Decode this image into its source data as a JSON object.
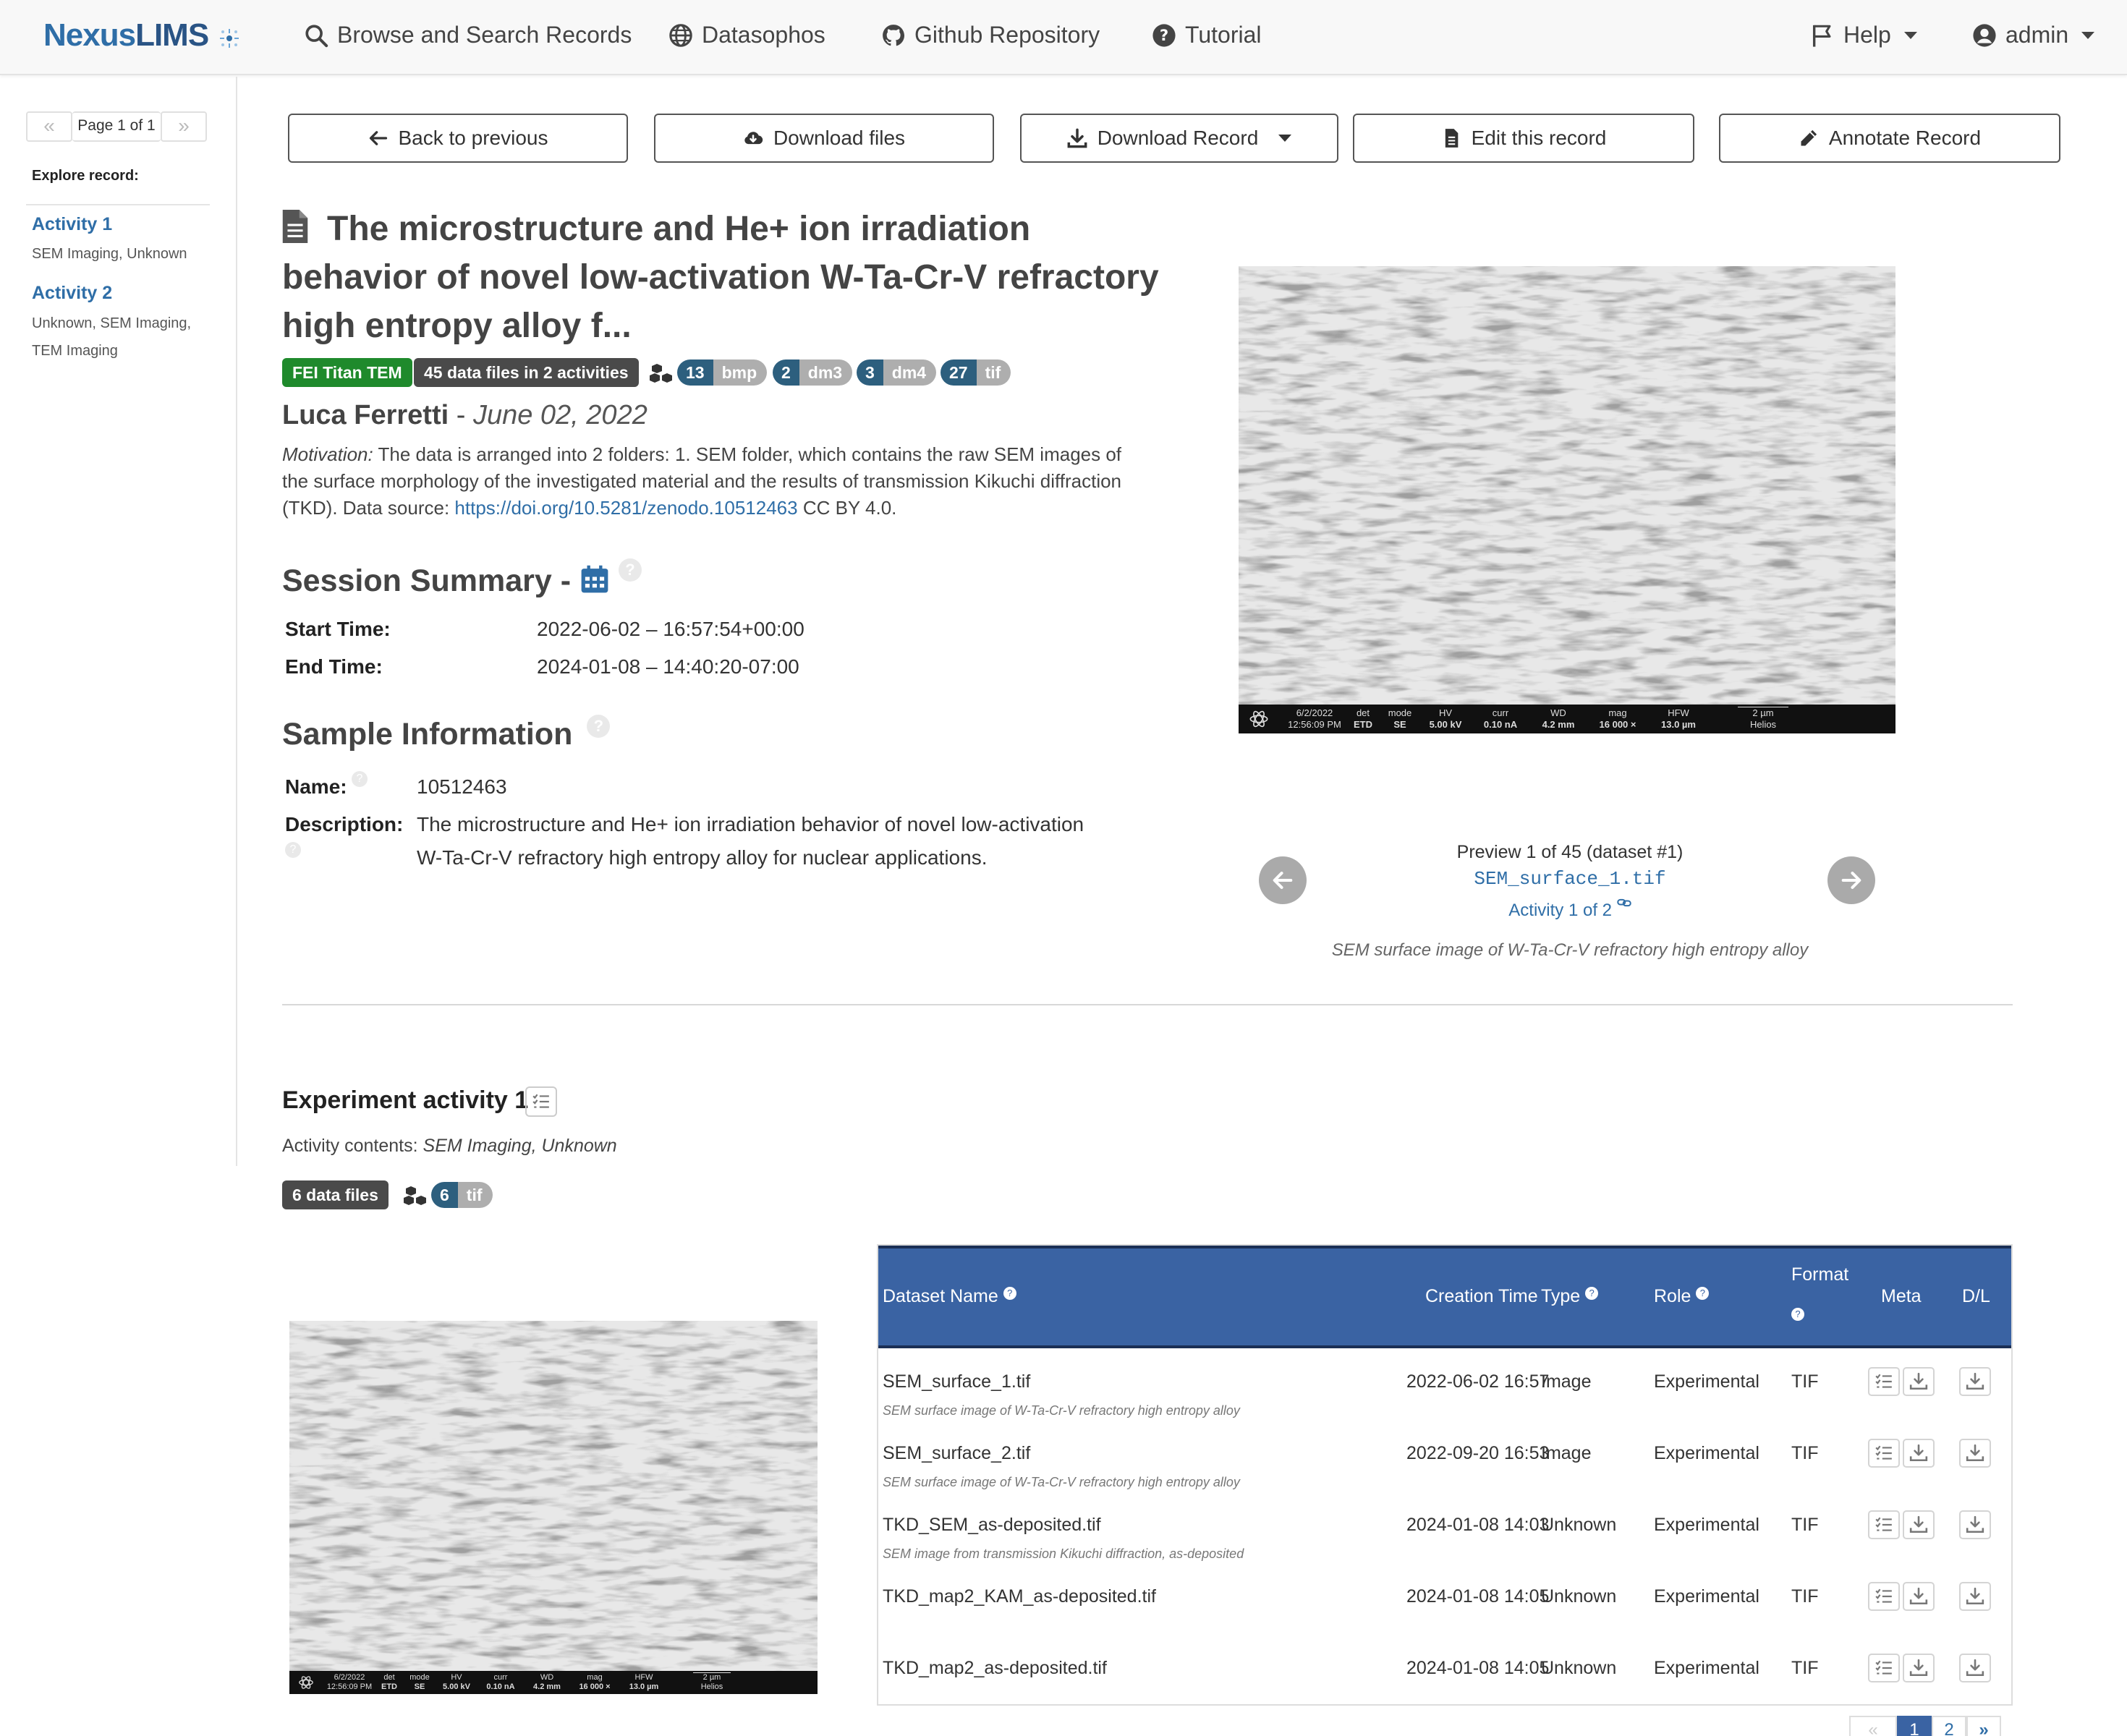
{
  "navbar": {
    "brand_nexus": "Nexus",
    "brand_lims": "LIMS",
    "items": [
      {
        "label": "Browse and Search Records",
        "icon": "search-icon"
      },
      {
        "label": "Datasophos",
        "icon": "globe-icon"
      },
      {
        "label": "Github Repository",
        "icon": "github-icon"
      },
      {
        "label": "Tutorial",
        "icon": "question-circle-icon"
      }
    ],
    "help": "Help",
    "user": "admin"
  },
  "sidebar": {
    "page_label": "Page 1 of 1",
    "explore_label": "Explore record:",
    "activities": [
      {
        "label": "Activity 1",
        "sub": "SEM Imaging, Unknown"
      },
      {
        "label": "Activity 2",
        "sub_line1": "Unknown, SEM Imaging,",
        "sub_line2": "TEM Imaging"
      }
    ]
  },
  "toolbar": {
    "back": "Back to previous",
    "download_files": "Download files",
    "download_record": "Download Record",
    "edit": "Edit this record",
    "annotate": "Annotate Record"
  },
  "record": {
    "title_line1": "The microstructure and He+ ion irradiation",
    "title_line2": "behavior of novel low-activation W-Ta-Cr-V refractory",
    "title_line3": "high entropy alloy f...",
    "instrument_badge": "FEI Titan TEM",
    "files_badge": "45 data files in 2 activities",
    "filetypes": [
      {
        "count": "13",
        "ext": "bmp"
      },
      {
        "count": "2",
        "ext": "dm3"
      },
      {
        "count": "3",
        "ext": "dm4"
      },
      {
        "count": "27",
        "ext": "tif"
      }
    ],
    "author": "Luca Ferretti",
    "date": "June 02, 2022",
    "motivation_label": "Motivation:",
    "motivation_text": "The data is arranged into 2 folders: 1. SEM folder, which contains the raw SEM images of the surface morphology of the investigated material and the results of transmission Kikuchi diffraction (TKD). Data source:",
    "motivation_link": "https://doi.org/10.5281/zenodo.10512463",
    "motivation_tail": "CC BY 4.0."
  },
  "session": {
    "heading": "Session Summary -",
    "start_label": "Start Time:",
    "start_value": "2022-06-02 – 16:57:54+00:00",
    "end_label": "End Time:",
    "end_value": "2024-01-08 – 14:40:20-07:00"
  },
  "sample": {
    "heading": "Sample Information",
    "name_label": "Name:",
    "name_value": "10512463",
    "desc_label": "Description:",
    "desc_line1": "The microstructure and He+ ion irradiation behavior of novel low-activation",
    "desc_line2": "W-Ta-Cr-V refractory high entropy alloy for nuclear applications."
  },
  "preview": {
    "counter": "Preview 1 of 45 (dataset #1)",
    "filename": "SEM_surface_1.tif",
    "activity_link": "Activity 1 of 2",
    "caption": "SEM surface image of W-Ta-Cr-V refractory high entropy alloy",
    "databar": {
      "date": "6/2/2022",
      "time": "12:56:09 PM",
      "det_label": "det",
      "det": "ETD",
      "mode_label": "mode",
      "mode": "SE",
      "hv_label": "HV",
      "hv": "5.00 kV",
      "curr_label": "curr",
      "curr": "0.10 nA",
      "wd_label": "WD",
      "wd": "4.2 mm",
      "mag_label": "mag",
      "mag": "16 000 ×",
      "hfw_label": "HFW",
      "hfw": "13.0 µm",
      "scale": "2 µm",
      "instrument": "Helios"
    }
  },
  "activity": {
    "title": "Experiment activity 1",
    "contents_label": "Activity contents:",
    "contents_value": "SEM Imaging, Unknown",
    "files_badge": "6 data files",
    "filetype": {
      "count": "6",
      "ext": "tif"
    }
  },
  "table": {
    "headers": {
      "name": "Dataset Name",
      "time": "Creation Time",
      "type": "Type",
      "role": "Role",
      "format": "Format",
      "meta": "Meta",
      "dl": "D/L"
    },
    "rows": [
      {
        "name": "SEM_surface_1.tif",
        "desc": "SEM surface image of W-Ta-Cr-V refractory high entropy alloy",
        "time": "2022-06-02 16:57",
        "type": "Image",
        "role": "Experimental",
        "format": "TIF"
      },
      {
        "name": "SEM_surface_2.tif",
        "desc": "SEM surface image of W-Ta-Cr-V refractory high entropy alloy",
        "time": "2022-09-20 16:53",
        "type": "Image",
        "role": "Experimental",
        "format": "TIF"
      },
      {
        "name": "TKD_SEM_as-deposited.tif",
        "desc": "SEM image from transmission Kikuchi diffraction, as-deposited",
        "time": "2024-01-08 14:03",
        "type": "Unknown",
        "role": "Experimental",
        "format": "TIF"
      },
      {
        "name": "TKD_map2_KAM_as-deposited.tif",
        "desc": "",
        "time": "2024-01-08 14:05",
        "type": "Unknown",
        "role": "Experimental",
        "format": "TIF"
      },
      {
        "name": "TKD_map2_as-deposited.tif",
        "desc": "",
        "time": "2024-01-08 14:05",
        "type": "Unknown",
        "role": "Experimental",
        "format": "TIF"
      }
    ],
    "pagination": {
      "current": "1",
      "next": "2"
    }
  },
  "colors": {
    "accent": "#2f6ea7",
    "table_header": "#3a63a3",
    "instrument_badge": "#1f8a2c",
    "dark_badge": "#4a4a4a"
  }
}
